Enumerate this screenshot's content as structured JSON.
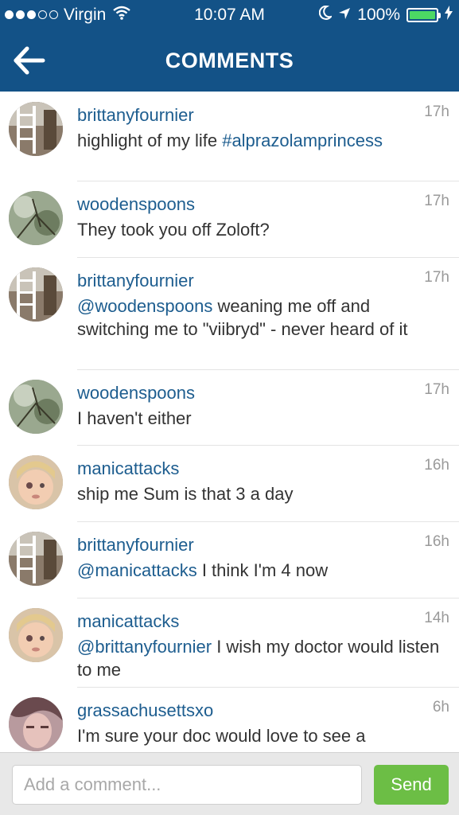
{
  "status_bar": {
    "carrier": "Virgin",
    "time": "10:07 AM",
    "battery": "100%",
    "signal_bars_filled": 3,
    "signal_bars_total": 5
  },
  "nav": {
    "title": "COMMENTS",
    "back_icon": "back-arrow-icon"
  },
  "colors": {
    "header": "#135287",
    "username": "#1d5d8f",
    "send": "#6cbe45",
    "battery": "#4cd964"
  },
  "comments": [
    {
      "username": "brittanyfournier",
      "time": "17h",
      "mention": "",
      "body": "highlight of my life ",
      "hashtag": "#alprazolamprincess"
    },
    {
      "username": "woodenspoons",
      "time": "17h",
      "mention": "",
      "body": "They took you off Zoloft?",
      "hashtag": ""
    },
    {
      "username": "brittanyfournier",
      "time": "17h",
      "mention": "@woodenspoons",
      "body": " weaning me off and switching me to \"viibryd\" - never heard of it",
      "hashtag": ""
    },
    {
      "username": "woodenspoons",
      "time": "17h",
      "mention": "",
      "body": "I haven't either",
      "hashtag": ""
    },
    {
      "username": "manicattacks",
      "time": "16h",
      "mention": "",
      "body": "ship me Sum is that 3 a day",
      "hashtag": ""
    },
    {
      "username": "brittanyfournier",
      "time": "16h",
      "mention": "@manicattacks",
      "body": " I think I'm 4 now",
      "hashtag": ""
    },
    {
      "username": "manicattacks",
      "time": "14h",
      "mention": "@brittanyfournier",
      "body": " I wish my doctor would listen to me",
      "hashtag": ""
    },
    {
      "username": "grassachusettsxo",
      "time": "6h",
      "mention": "",
      "body": "I'm sure your doc would love to see a screenshot of this post",
      "hashtag": ""
    }
  ],
  "composer": {
    "placeholder": "Add a comment...",
    "send_label": "Send"
  }
}
